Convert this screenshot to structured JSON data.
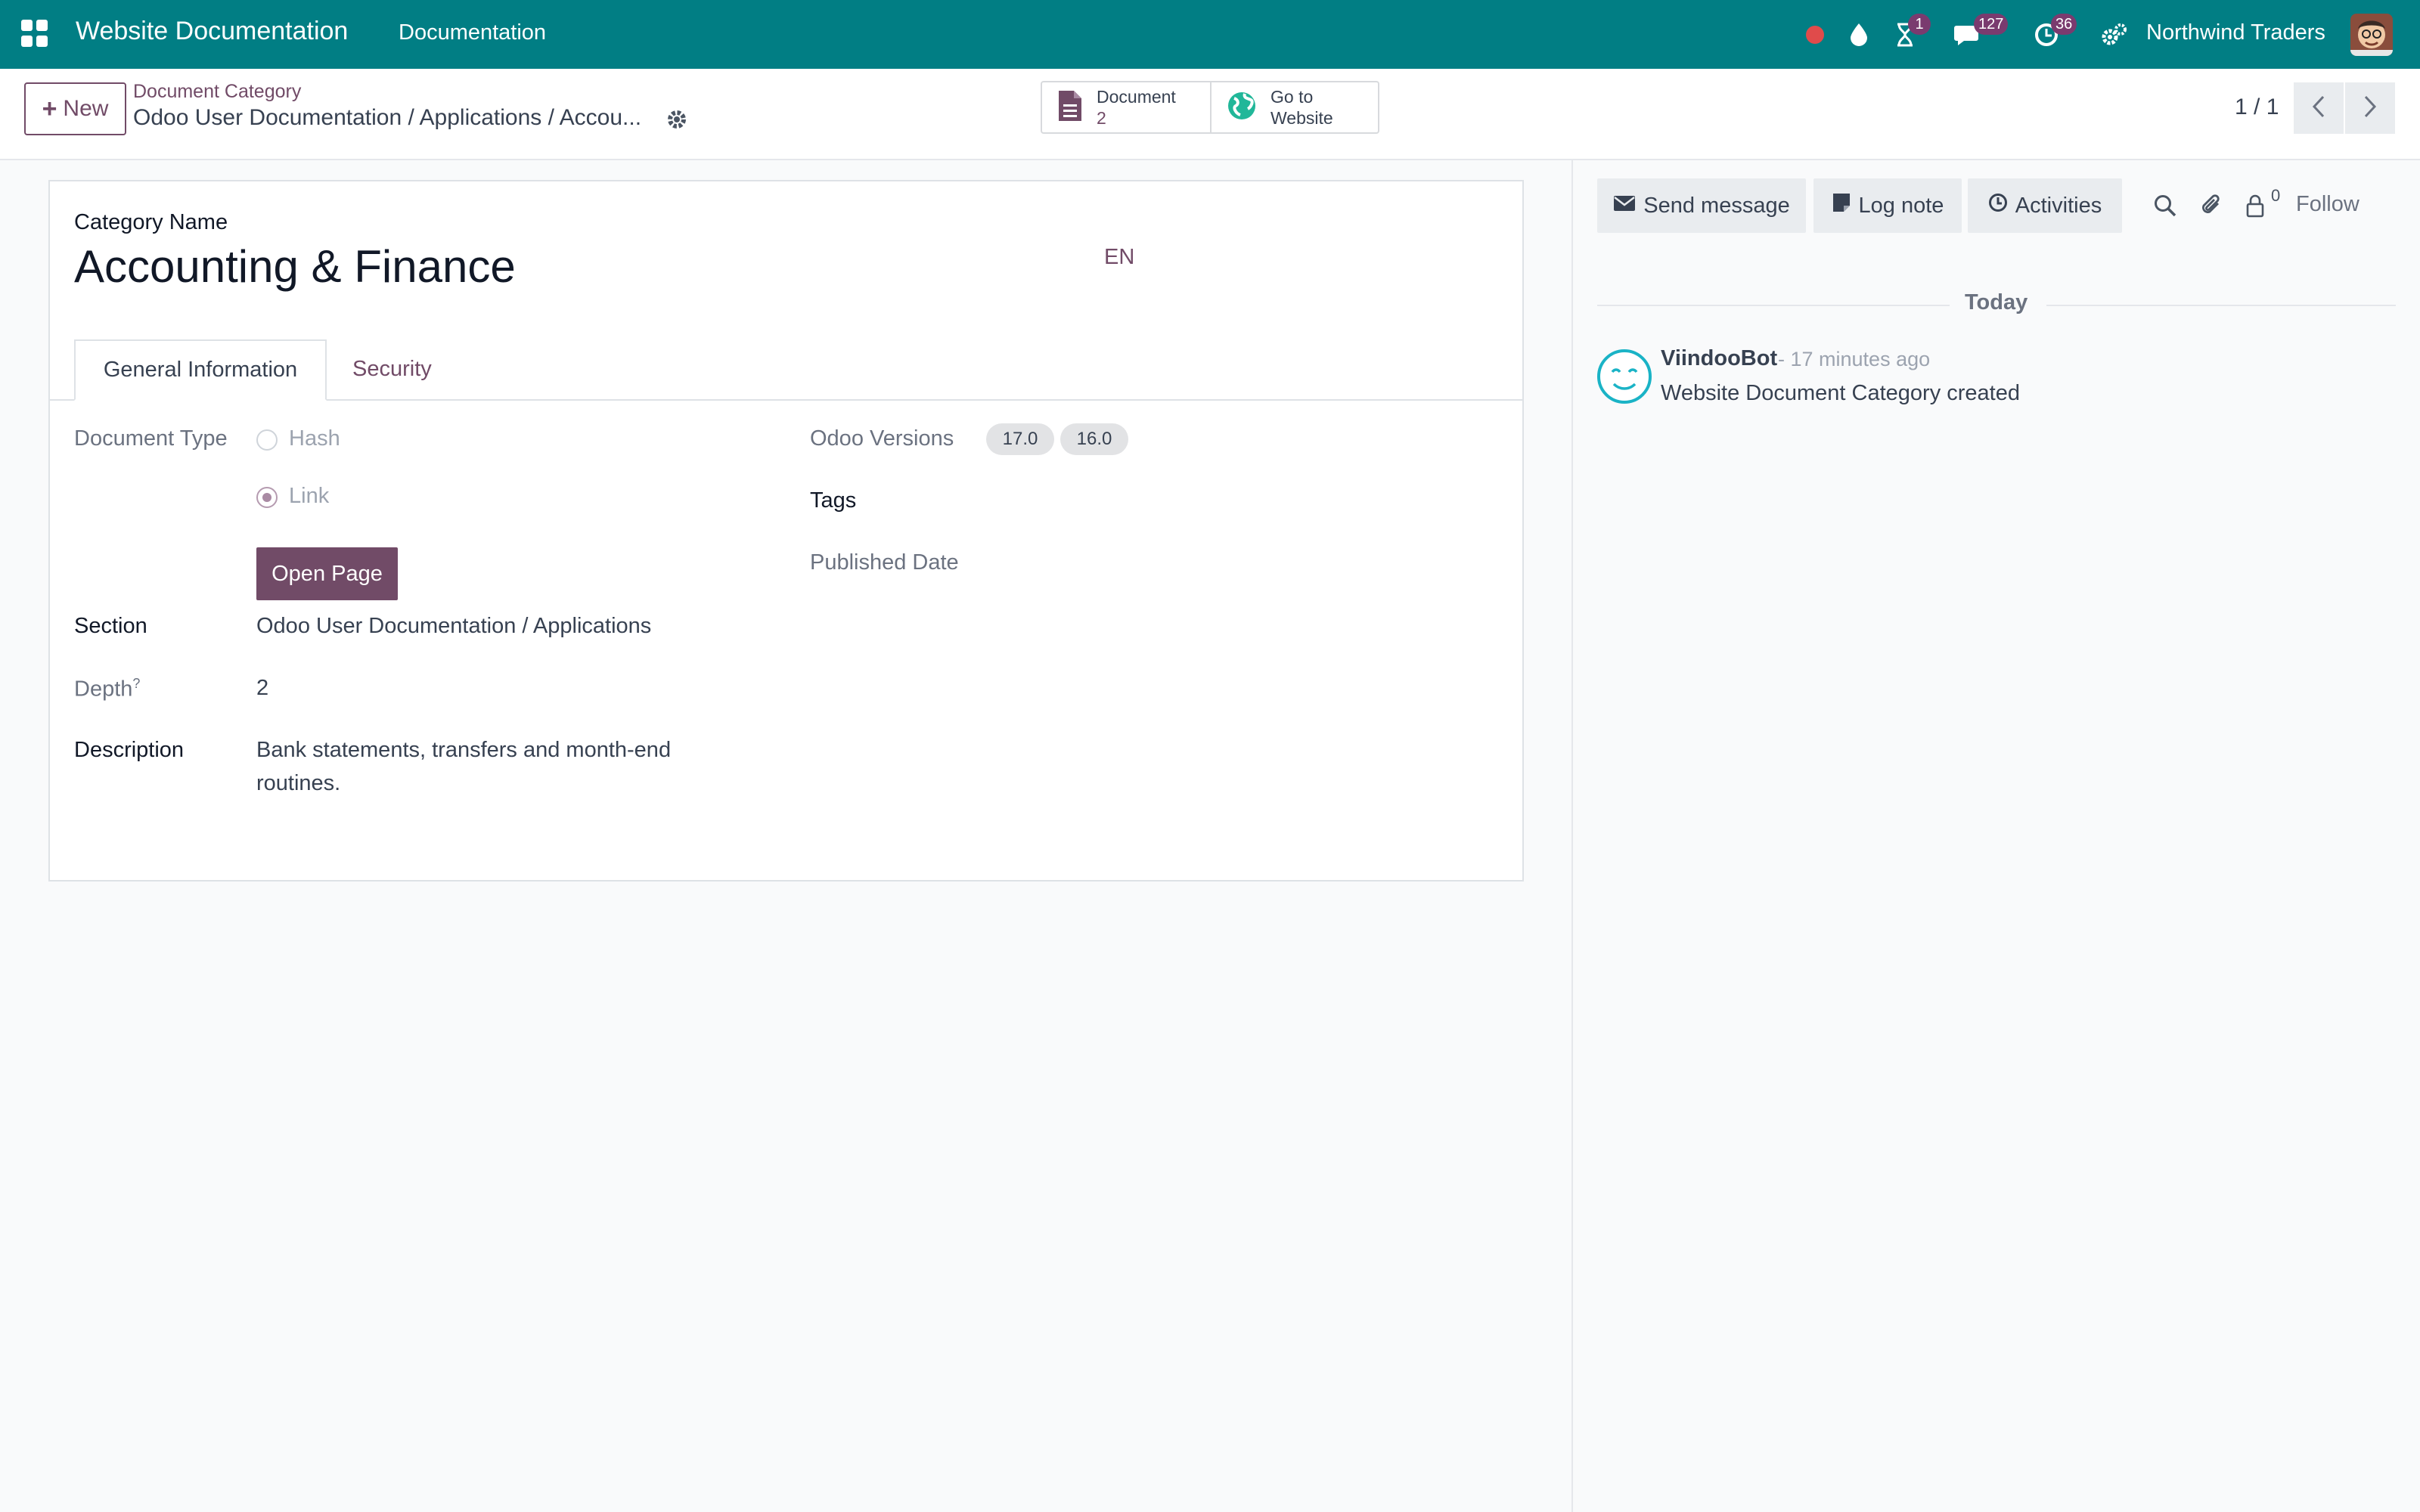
{
  "navbar": {
    "app_name": "Website Documentation",
    "menu_item": "Documentation",
    "activity_badge": "1",
    "messages_badge": "127",
    "activities_badge": "36",
    "company": "Northwind Traders",
    "bg_color": "#017e84"
  },
  "control_panel": {
    "new_label": "New",
    "breadcrumb_parent": "Document Category",
    "breadcrumb_current": "Odoo User Documentation / Applications / Accou...",
    "smart_buttons": [
      {
        "label": "Document",
        "value": "2",
        "icon": "file-icon"
      },
      {
        "label": "Go to",
        "value": "Website",
        "icon": "globe-icon"
      }
    ],
    "pager": "1 / 1"
  },
  "form": {
    "category_name_label": "Category Name",
    "category_name": "Accounting & Finance",
    "lang": "EN",
    "tabs": [
      {
        "label": "General Information",
        "active": true
      },
      {
        "label": "Security",
        "active": false
      }
    ],
    "document_type_label": "Document Type",
    "document_type_options": [
      {
        "label": "Hash",
        "selected": false
      },
      {
        "label": "Link",
        "selected": true
      }
    ],
    "open_page_label": "Open Page",
    "section_label": "Section",
    "section_value": "Odoo User Documentation / Applications",
    "depth_label": "Depth",
    "depth_help": "?",
    "depth_value": "2",
    "description_label": "Description",
    "description_line1": "Bank statements, transfers and month-end",
    "description_line2": "routines.",
    "odoo_versions_label": "Odoo Versions",
    "odoo_versions": [
      "17.0",
      "16.0"
    ],
    "tags_label": "Tags",
    "published_date_label": "Published Date"
  },
  "chatter": {
    "send_message_label": "Send message",
    "log_note_label": "Log note",
    "activities_label": "Activities",
    "followers_count": "0",
    "follow_label": "Follow",
    "today_label": "Today",
    "messages": [
      {
        "author": "ViindooBot",
        "time": "- 17 minutes ago",
        "body": "Website Document Category created"
      }
    ]
  },
  "colors": {
    "primary": "#714b67",
    "teal": "#017e84"
  }
}
